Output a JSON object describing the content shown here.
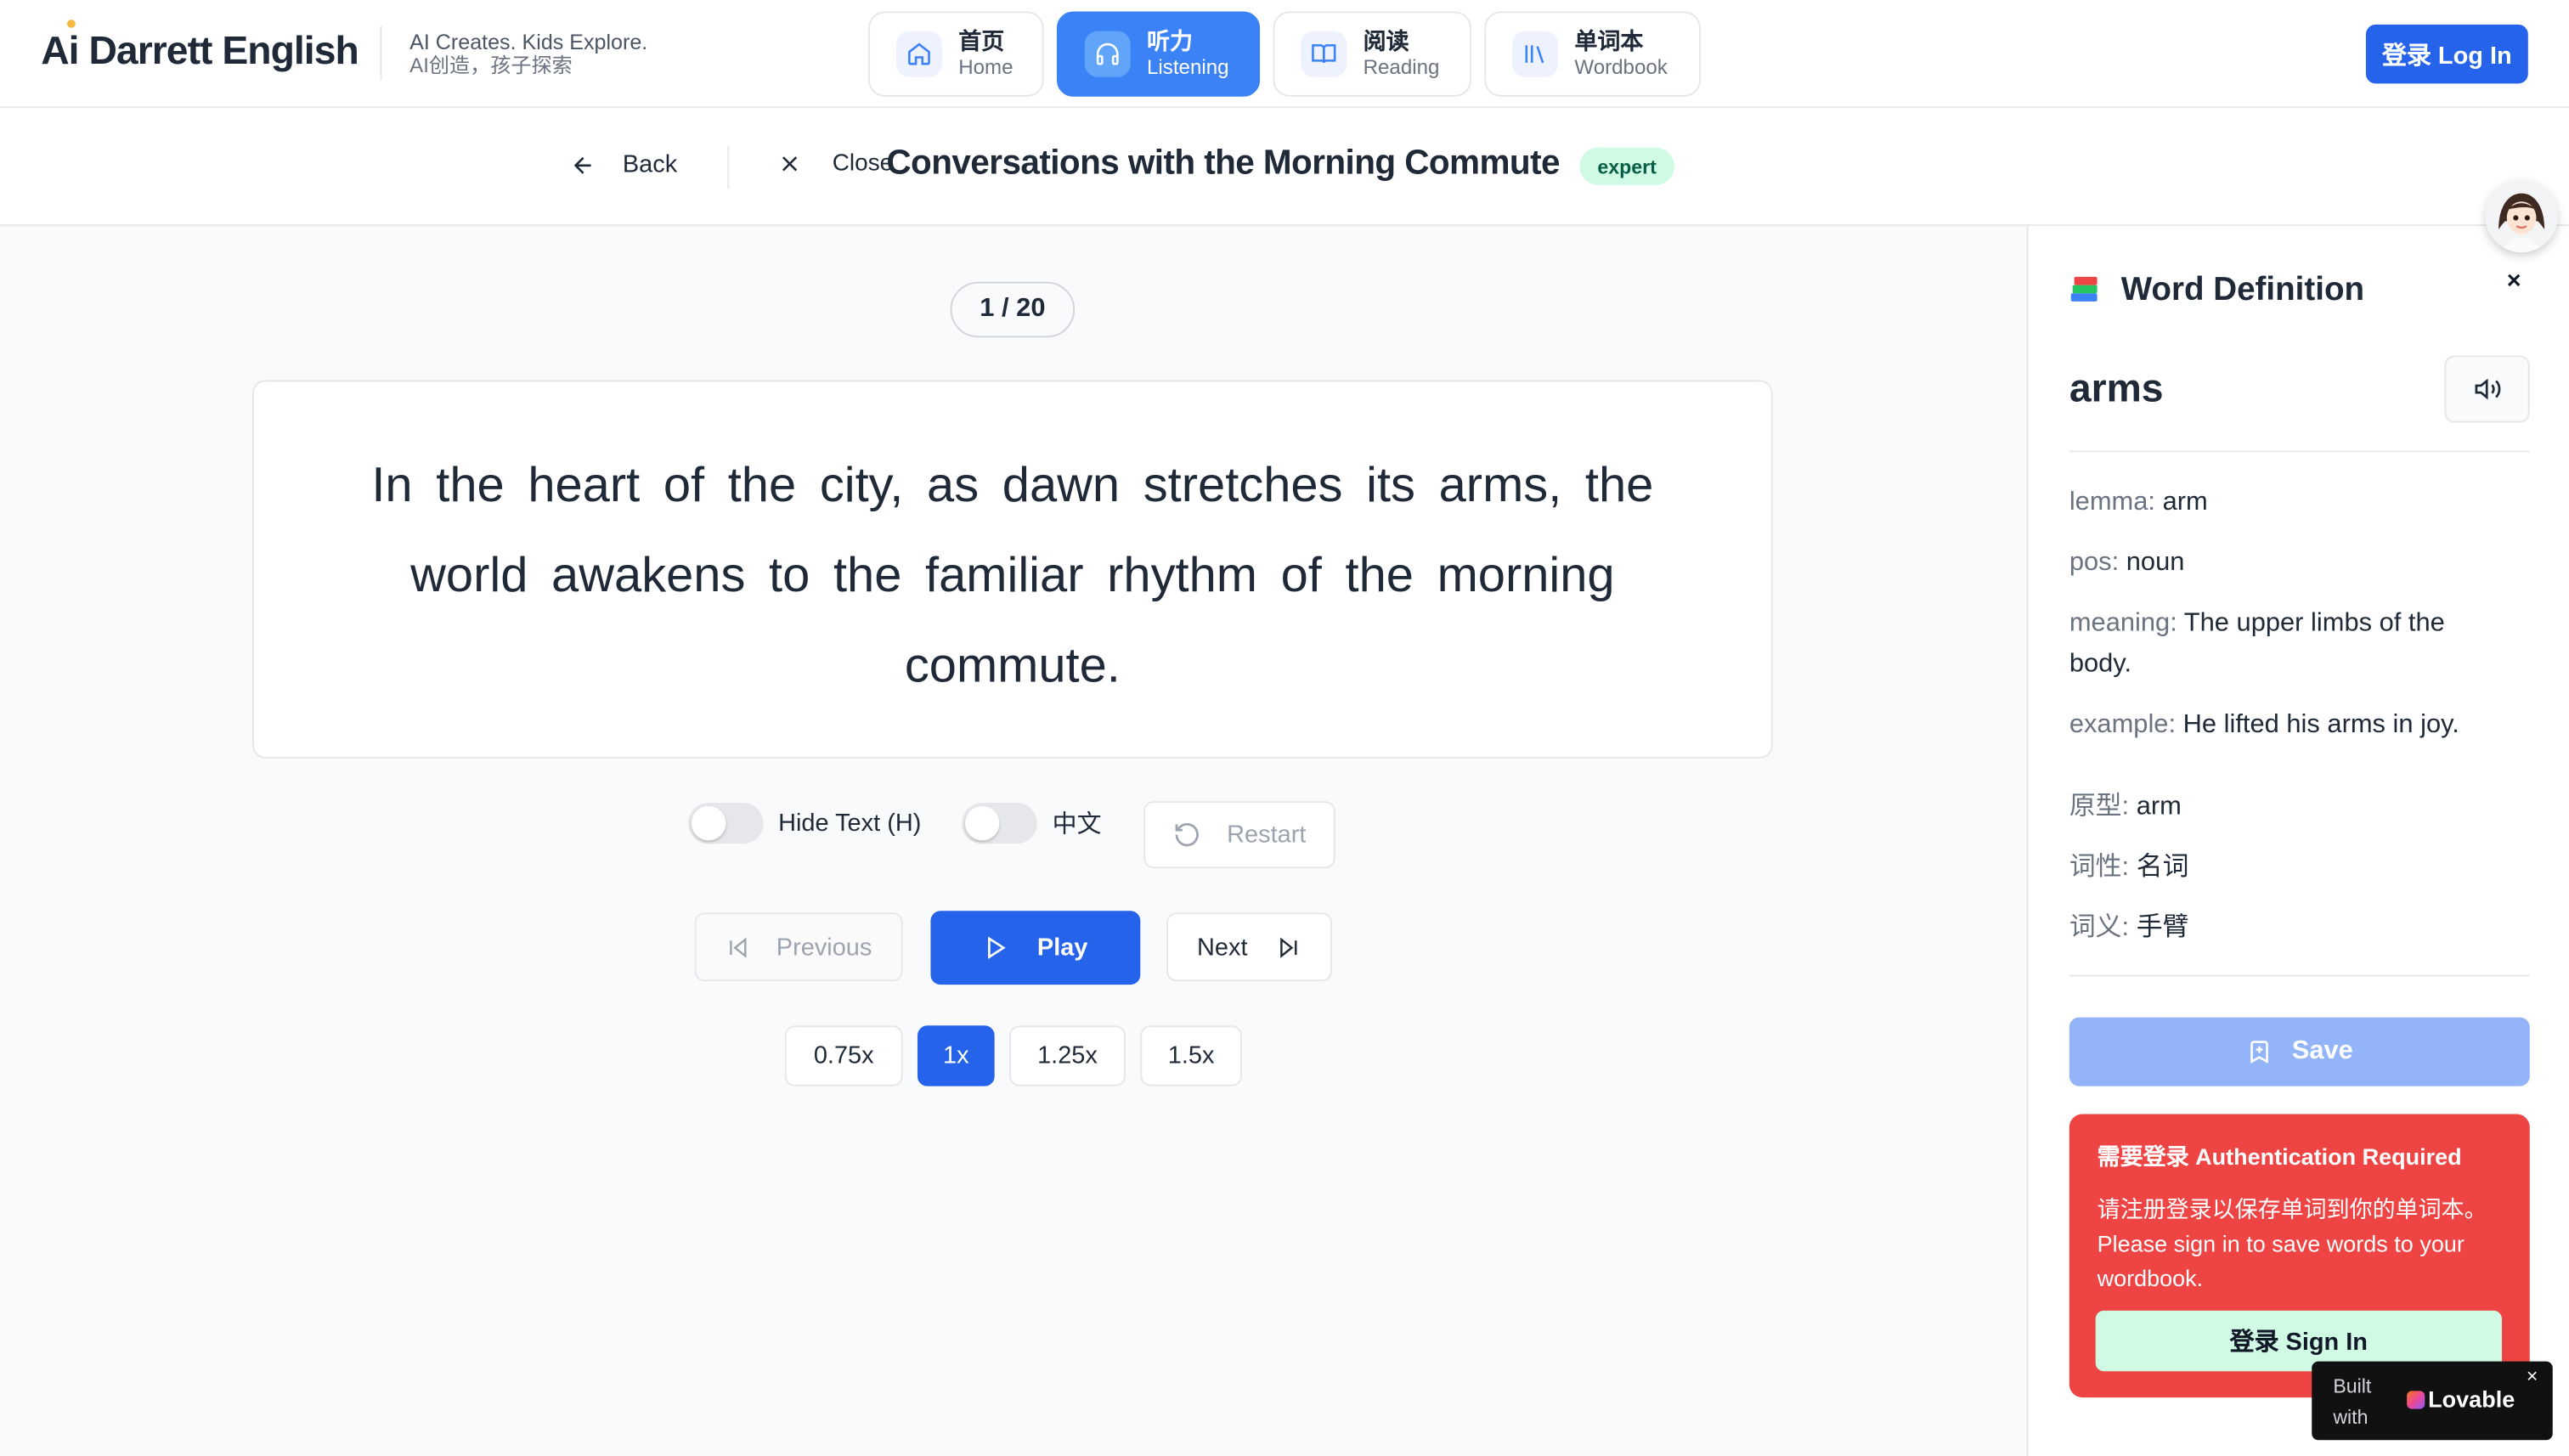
{
  "brand": {
    "name": "Ai Darrett English",
    "tagline_en": "AI Creates. Kids Explore.",
    "tagline_zh": "AI创造，孩子探索"
  },
  "nav": {
    "tabs": [
      {
        "zh": "首页",
        "en": "Home",
        "icon": "home-icon",
        "active": false
      },
      {
        "zh": "听力",
        "en": "Listening",
        "icon": "headphones-icon",
        "active": true
      },
      {
        "zh": "阅读",
        "en": "Reading",
        "icon": "book-open-icon",
        "active": false
      },
      {
        "zh": "单词本",
        "en": "Wordbook",
        "icon": "library-icon",
        "active": false
      }
    ],
    "login_label": "登录 Log In"
  },
  "subheader": {
    "back_label": "Back",
    "close_label": "Close",
    "title": "Conversations with the Morning Commute",
    "level": "expert"
  },
  "player": {
    "counter": "1 / 20",
    "sentence": "In the heart of the city, as dawn stretches its arms, the world awakens to the familiar rhythm of the morning commute.",
    "hide_text_label": "Hide Text (H)",
    "chinese_label": "中文",
    "hide_text_on": false,
    "chinese_on": false,
    "restart_label": "Restart",
    "previous_label": "Previous",
    "play_label": "Play",
    "next_label": "Next",
    "speeds": [
      "0.75x",
      "1x",
      "1.25x",
      "1.5x"
    ],
    "selected_speed": "1x"
  },
  "word_panel": {
    "title": "Word Definition",
    "title_icon": "books-emoji",
    "close_label": "×",
    "word": "arms",
    "fields_en": [
      {
        "key": "lemma:",
        "value": "arm"
      },
      {
        "key": "pos:",
        "value": "noun"
      },
      {
        "key": "meaning:",
        "value": "The upper limbs of the body."
      },
      {
        "key": "example:",
        "value": "He lifted his arms in joy."
      }
    ],
    "fields_zh": [
      {
        "key": "原型:",
        "value": "arm"
      },
      {
        "key": "词性:",
        "value": "名词"
      },
      {
        "key": "词义:",
        "value": "手臂"
      }
    ],
    "save_label": "Save",
    "auth": {
      "title": "需要登录 Authentication Required",
      "body_zh": "请注册登录以保存单词到你的单词本。",
      "body_en": "Please sign in to save words to your wordbook.",
      "button_label": "登录 Sign In"
    }
  },
  "badge": {
    "built_with": "Built with",
    "name": "Lovable",
    "close": "×"
  },
  "colors": {
    "primary": "#2563eb",
    "active_tab": "#3b82f6",
    "auth_bg": "#ef4444",
    "level_badge_bg": "#d1fae5"
  }
}
